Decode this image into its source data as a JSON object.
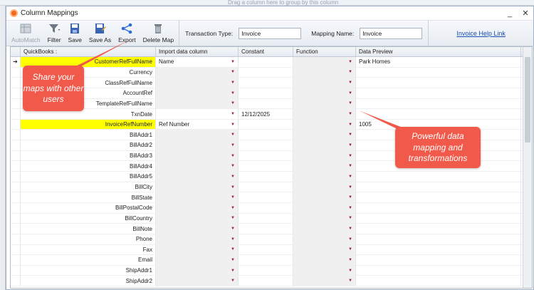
{
  "background": {
    "drag_hint": "Drag a column here to group by this column"
  },
  "window": {
    "title": "Column Mappings",
    "min_glyph": "_",
    "close_glyph": "✕"
  },
  "toolbar": {
    "buttons": [
      {
        "label": "AutoMatch",
        "icon": "automatch-icon",
        "enabled": false
      },
      {
        "label": "Filter",
        "icon": "filter-icon",
        "enabled": true
      },
      {
        "label": "Save",
        "icon": "save-icon",
        "enabled": true
      },
      {
        "label": "Save As",
        "icon": "save-as-icon",
        "enabled": true
      },
      {
        "label": "Export",
        "icon": "share-icon",
        "enabled": true
      },
      {
        "label": "Delete Map",
        "icon": "trash-icon",
        "enabled": true
      }
    ],
    "transaction_type_label": "Transaction Type:",
    "transaction_type_value": "Invoice",
    "mapping_name_label": "Mapping Name:",
    "mapping_name_value": "Invoice",
    "help_link": "Invoice Help Link"
  },
  "grid": {
    "headers": [
      "QuickBooks :",
      "Import data column",
      "Constant",
      "Function",
      "Data Preview"
    ],
    "rows": [
      {
        "field": "CustomerRefFullName",
        "import": "Name",
        "constant": "",
        "preview": "Park Homes",
        "highlight": true,
        "current": true
      },
      {
        "field": "Currency",
        "import": "",
        "constant": "",
        "preview": ""
      },
      {
        "field": "ClassRefFullName",
        "import": "",
        "constant": "",
        "preview": ""
      },
      {
        "field": "AccountRef",
        "import": "",
        "constant": "",
        "preview": ""
      },
      {
        "field": "TemplateRefFullName",
        "import": "",
        "constant": "",
        "preview": ""
      },
      {
        "field": "TxnDate",
        "import": "",
        "constant": "12/12/2025",
        "preview": "",
        "white_import": true
      },
      {
        "field": "InvoiceRefNumber",
        "import": "Ref Number",
        "constant": "",
        "preview": "1005",
        "highlight": true
      },
      {
        "field": "BillAddr1",
        "import": "",
        "constant": "",
        "preview": ""
      },
      {
        "field": "BillAddr2",
        "import": "",
        "constant": "",
        "preview": ""
      },
      {
        "field": "BillAddr3",
        "import": "",
        "constant": "",
        "preview": ""
      },
      {
        "field": "BillAddr4",
        "import": "",
        "constant": "",
        "preview": ""
      },
      {
        "field": "BillAddr5",
        "import": "",
        "constant": "",
        "preview": ""
      },
      {
        "field": "BillCity",
        "import": "",
        "constant": "",
        "preview": ""
      },
      {
        "field": "BillState",
        "import": "",
        "constant": "",
        "preview": ""
      },
      {
        "field": "BillPostalCode",
        "import": "",
        "constant": "",
        "preview": ""
      },
      {
        "field": "BillCountry",
        "import": "",
        "constant": "",
        "preview": ""
      },
      {
        "field": "BillNote",
        "import": "",
        "constant": "",
        "preview": ""
      },
      {
        "field": "Phone",
        "import": "",
        "constant": "",
        "preview": ""
      },
      {
        "field": "Fax",
        "import": "",
        "constant": "",
        "preview": ""
      },
      {
        "field": "Email",
        "import": "",
        "constant": "",
        "preview": ""
      },
      {
        "field": "ShipAddr1",
        "import": "",
        "constant": "",
        "preview": ""
      },
      {
        "field": "ShipAddr2",
        "import": "",
        "constant": "",
        "preview": ""
      }
    ],
    "current_row_glyph": "➔",
    "dropdown_glyph": "▼"
  },
  "callouts": {
    "share": "Share your maps with other users",
    "power": "Powerful data mapping and transformations"
  },
  "colors": {
    "highlight": "#ffff00",
    "callout": "#f15a4a",
    "link": "#1a4fb4"
  }
}
